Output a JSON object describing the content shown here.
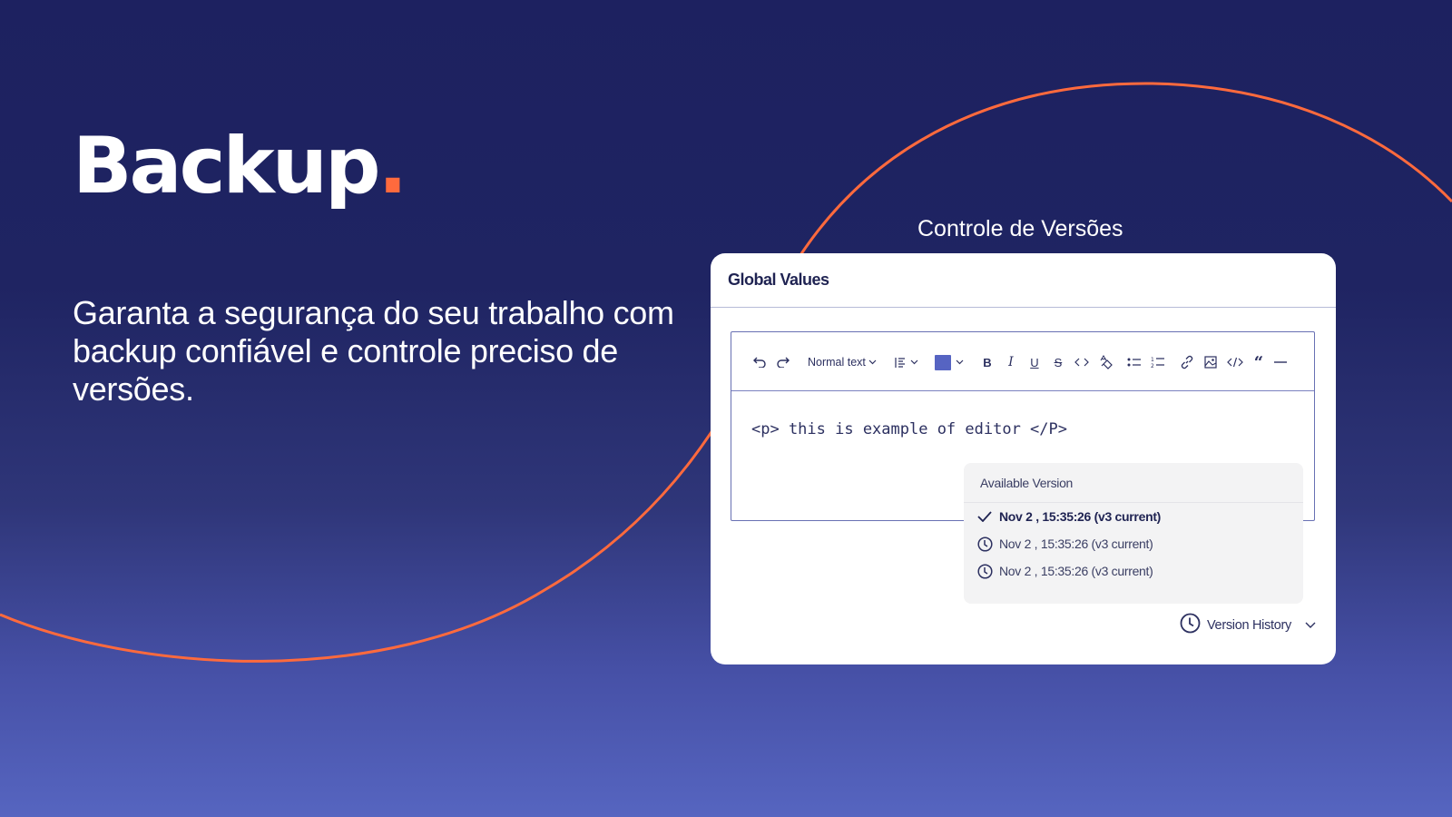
{
  "hero": {
    "title": "Backup",
    "title_dot": ".",
    "subtitle": "Garanta a segurança do seu trabalho com backup confiável e controle preciso de versões."
  },
  "section_label": "Controle de Versões",
  "colors": {
    "accent": "#ff6a3d",
    "background_top": "#1d2160",
    "background_bottom": "#5665c0",
    "card_text": "#1f2352",
    "color_swatch": "#5664c2"
  },
  "card": {
    "title": "Global Values",
    "toolbar": {
      "undo": "undo-icon",
      "redo": "redo-icon",
      "text_style": "Normal text",
      "align": "align-left-icon",
      "color": "text-color-swatch",
      "bold": "B",
      "italic": "I",
      "underline": "U",
      "strikethrough": "S",
      "code_inline": "code-icon",
      "clear_format": "clear-format-icon",
      "bullet_list": "bullet-list-icon",
      "numbered_list": "numbered-list-icon",
      "link": "link-icon",
      "image": "image-icon",
      "code_block": "code-block-icon",
      "quote": "quote-icon",
      "horizontal_rule": "horizontal-rule-icon"
    },
    "editor_content": "<p> this is example of editor </P>",
    "version_menu": {
      "header": "Available Version",
      "items": [
        {
          "label": "Nov 2 , 15:35:26 (v3 current)",
          "icon": "check-icon",
          "selected": true
        },
        {
          "label": "Nov 2 , 15:35:26 (v3 current)",
          "icon": "clock-icon",
          "selected": false
        },
        {
          "label": "Nov 2 , 15:35:26 (v3 current)",
          "icon": "clock-icon",
          "selected": false
        }
      ]
    },
    "version_history_label": "Version History"
  }
}
